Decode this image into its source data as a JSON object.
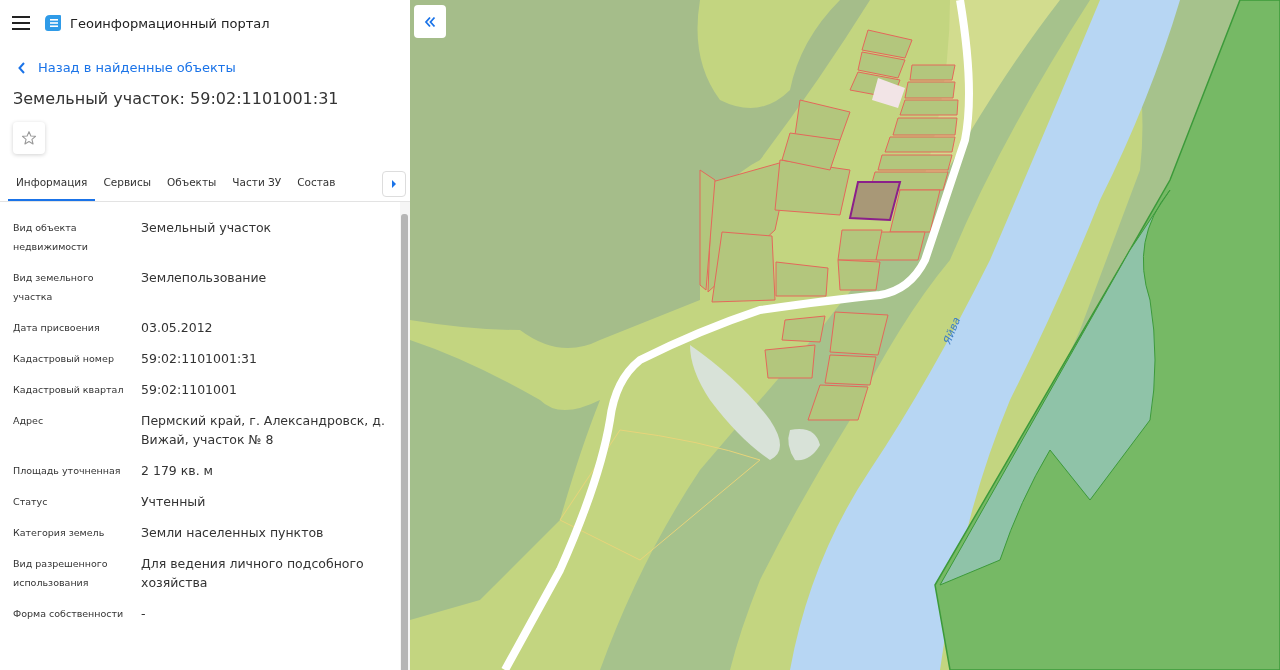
{
  "header": {
    "title": "Геоинформационный портал"
  },
  "back_link": "Назад в найденные объекты",
  "object_title": "Земельный участок: 59:02:1101001:31",
  "tabs": [
    {
      "label": "Информация",
      "selected": true
    },
    {
      "label": "Сервисы",
      "selected": false
    },
    {
      "label": "Объекты",
      "selected": false
    },
    {
      "label": "Части ЗУ",
      "selected": false
    },
    {
      "label": "Состав",
      "selected": false
    }
  ],
  "fields": [
    {
      "label": "Вид объекта недвижимости",
      "value": "Земельный участок"
    },
    {
      "label": "Вид земельного участка",
      "value": "Землепользование"
    },
    {
      "label": "Дата присвоения",
      "value": "03.05.2012"
    },
    {
      "label": "Кадастровый номер",
      "value": "59:02:1101001:31"
    },
    {
      "label": "Кадастровый квартал",
      "value": "59:02:1101001"
    },
    {
      "label": "Адрес",
      "value": "Пермский край, г. Александровск, д. Вижай, участок № 8"
    },
    {
      "label": "Площадь уточненная",
      "value": "2 179 кв. м"
    },
    {
      "label": "Статус",
      "value": "Учтенный"
    },
    {
      "label": "Категория земель",
      "value": "Земли населенных пунктов"
    },
    {
      "label": "Вид разрешенного использования",
      "value": "Для ведения личного подсобного хозяйства"
    },
    {
      "label": "Форма собственности",
      "value": "-"
    }
  ],
  "map": {
    "river_label": "Яйва"
  }
}
